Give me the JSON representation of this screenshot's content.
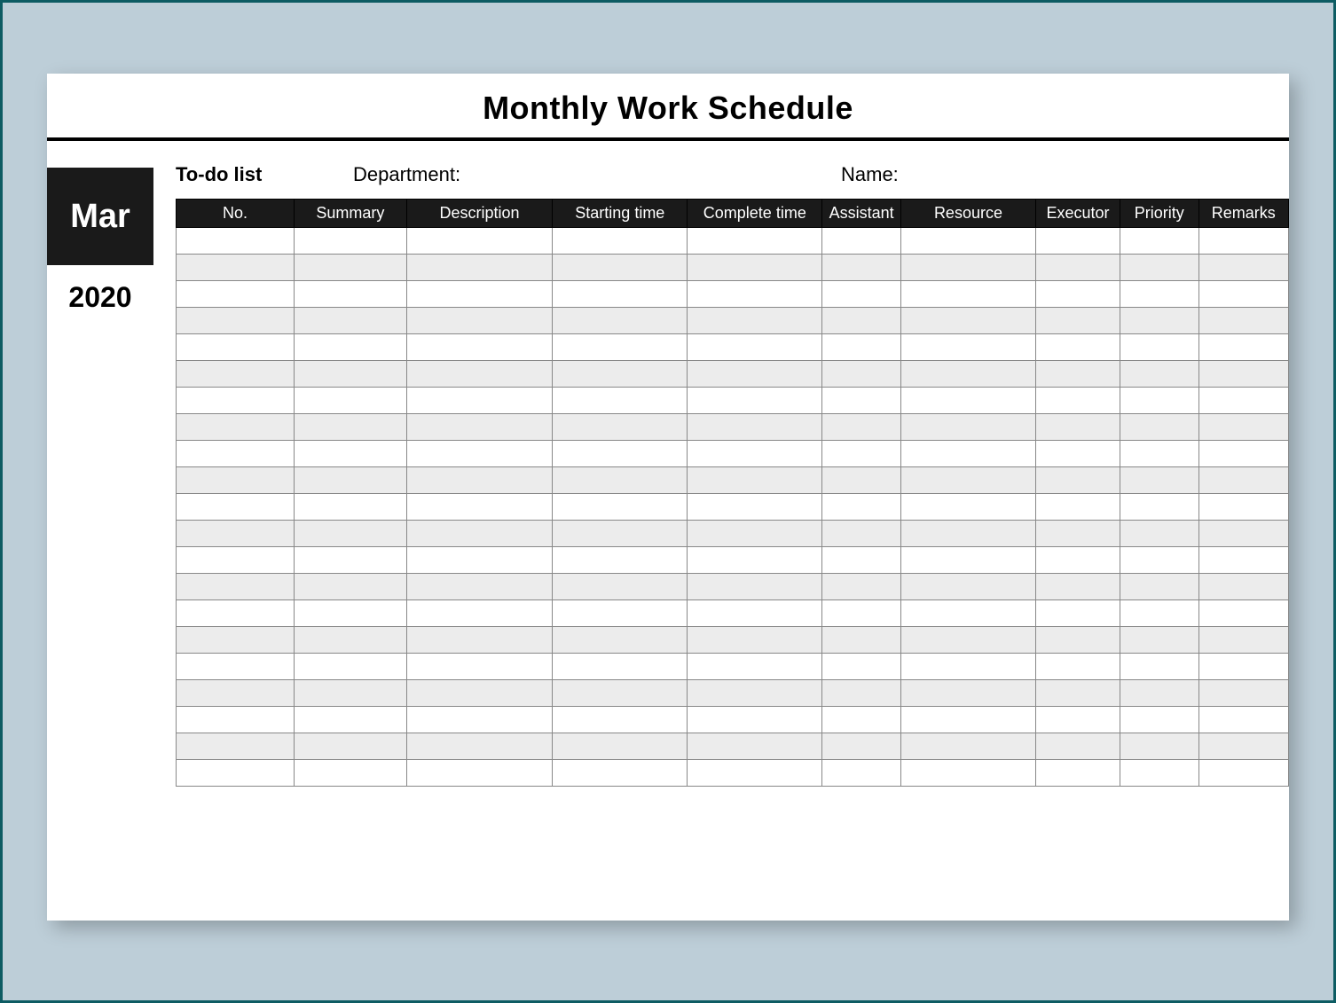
{
  "title": "Monthly Work Schedule",
  "sidebar": {
    "month": "Mar",
    "year": "2020"
  },
  "header": {
    "todo_label": "To-do list",
    "department_label": "Department:",
    "name_label": "Name:"
  },
  "table": {
    "columns": [
      "No.",
      "Summary",
      "Description",
      "Starting time",
      "Complete time",
      "Assistant",
      "Resource",
      "Executor",
      "Priority",
      "Remarks"
    ],
    "row_count": 21
  }
}
